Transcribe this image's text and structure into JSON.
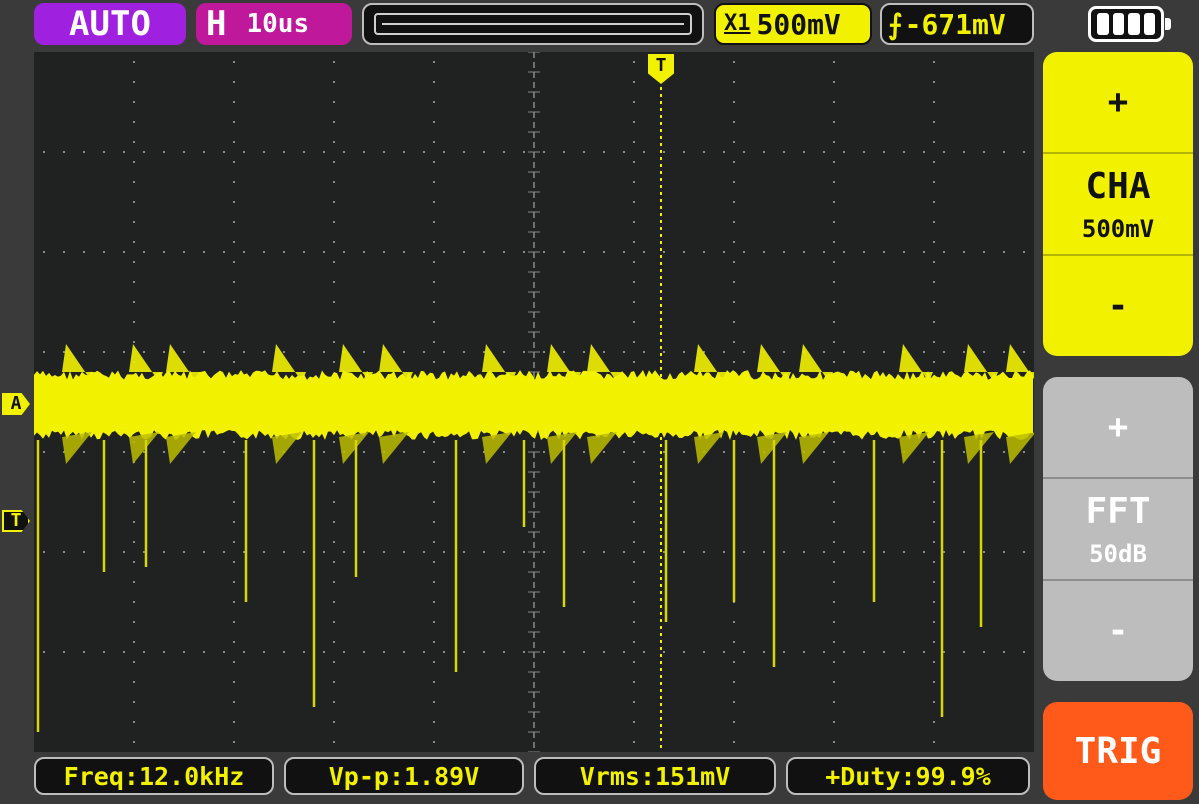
{
  "topbar": {
    "mode": "AUTO",
    "timebase_label": "H",
    "timebase_value": "10us",
    "channel_scale_icon": "X1",
    "channel_scale": "500mV",
    "trigger_edge_icon": "rising-edge-icon",
    "trigger_level": "-671mV",
    "battery_icon": "battery-full-icon"
  },
  "markers": {
    "channel": "A",
    "trigger_level": "T",
    "trigger_position": "T"
  },
  "side_panel": {
    "channel": {
      "plus": "+",
      "name": "CHA",
      "value": "500mV",
      "minus": "-"
    },
    "math": {
      "plus": "+",
      "name": "FFT",
      "value": "50dB",
      "minus": "-"
    },
    "trig_button": "TRIG"
  },
  "measurements": [
    {
      "label": "Freq",
      "value": "12.0kHz"
    },
    {
      "label": "Vp-p",
      "value": "1.89V"
    },
    {
      "label": "Vrms",
      "value": "151mV"
    },
    {
      "label": "+Duty",
      "value": "99.9%"
    }
  ],
  "colors": {
    "trace": "#f2f200",
    "mode_badge": "#a020e0",
    "timebase_badge": "#c0189a",
    "trig_button": "#ff5a1a",
    "screen_bg": "#1f2220"
  }
}
